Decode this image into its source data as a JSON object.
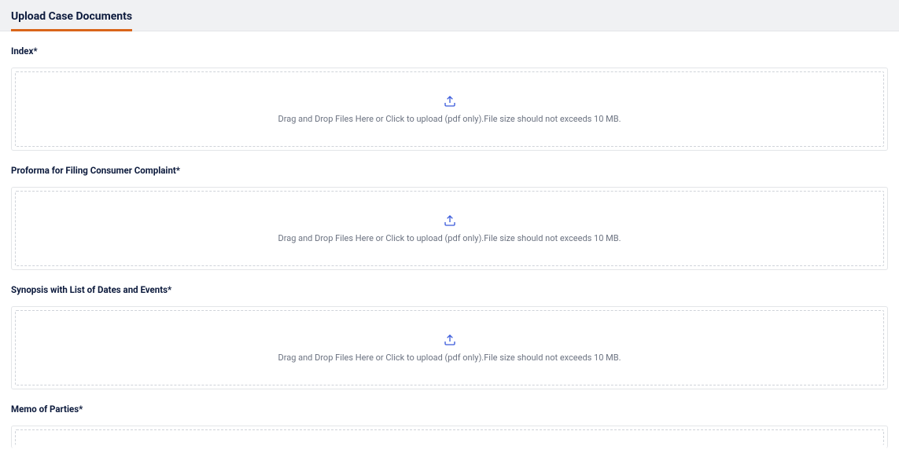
{
  "header": {
    "title": "Upload Case Documents"
  },
  "uploadInstructions": "Drag and Drop Files Here or Click to upload (pdf only).File size should not exceeds 10 MB.",
  "sections": [
    {
      "label": "Index*"
    },
    {
      "label": "Proforma for Filing Consumer Complaint*"
    },
    {
      "label": "Synopsis with List of Dates and Events*"
    },
    {
      "label": "Memo of Parties*"
    }
  ]
}
